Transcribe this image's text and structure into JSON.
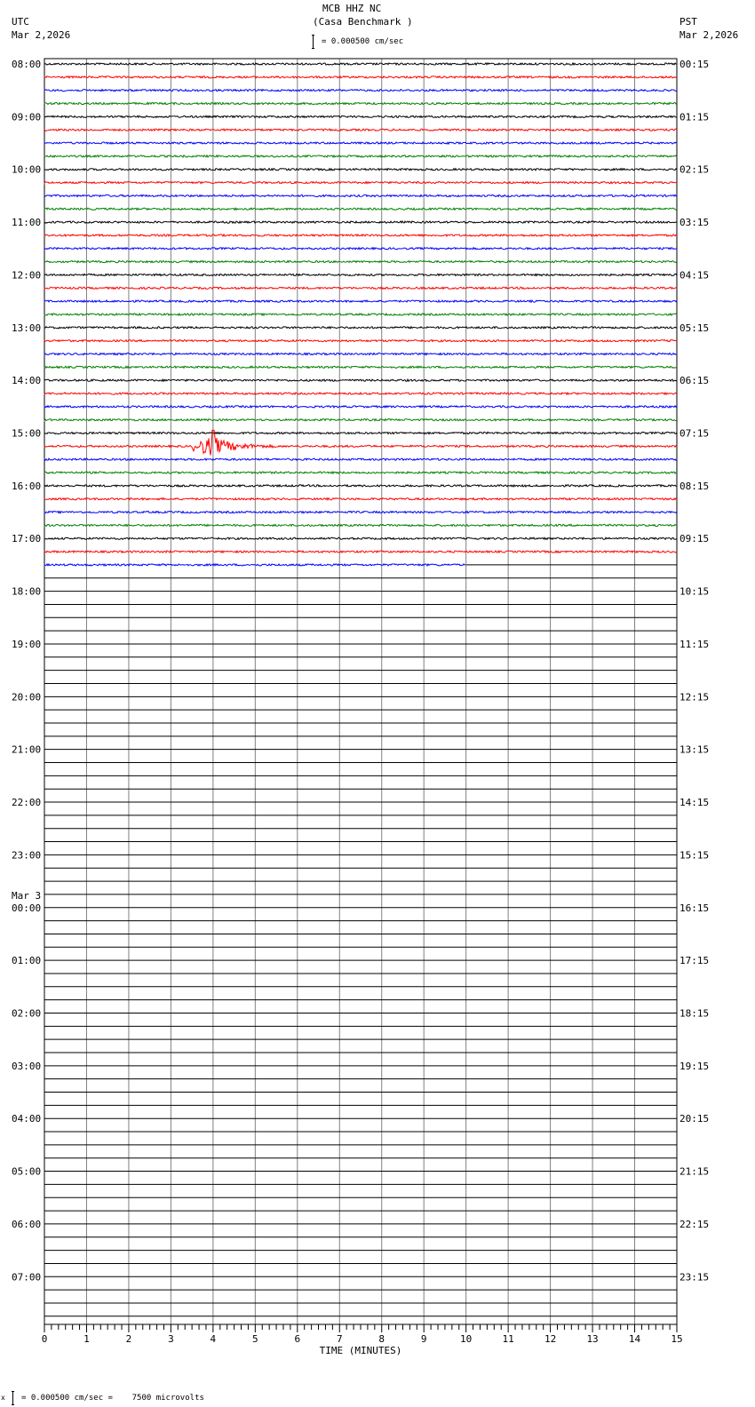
{
  "header": {
    "title": "MCB HHZ NC",
    "subtitle": "(Casa Benchmark )",
    "scale_text": "= 0.000500 cm/sec",
    "left_tz": "UTC",
    "left_date": "Mar 2,2026",
    "right_tz": "PST",
    "right_date": "Mar 2,2026"
  },
  "footer": {
    "scale_text": "= 0.000500 cm/sec =    7500 microvolts",
    "prefix": "x"
  },
  "chart_data": {
    "type": "line",
    "title": "MCB HHZ NC (Casa Benchmark )",
    "xlabel": "TIME (MINUTES)",
    "xlim": [
      0,
      15
    ],
    "x_ticks": [
      "0",
      "1",
      "2",
      "3",
      "4",
      "5",
      "6",
      "7",
      "8",
      "9",
      "10",
      "11",
      "12",
      "13",
      "14",
      "15"
    ],
    "rows_total": 96,
    "row_minutes": 15,
    "trace_colors": [
      "#000000",
      "#ff0000",
      "#0000ff",
      "#008000"
    ],
    "left_labels": [
      "08:00",
      "09:00",
      "10:00",
      "11:00",
      "12:00",
      "13:00",
      "14:00",
      "15:00",
      "16:00",
      "17:00",
      "18:00",
      "19:00",
      "20:00",
      "21:00",
      "22:00",
      "23:00",
      "00:00",
      "01:00",
      "02:00",
      "03:00",
      "04:00",
      "05:00",
      "06:00",
      "07:00"
    ],
    "date_change_label": "Mar 3",
    "date_change_hour_index": 16,
    "right_labels": [
      "00:15",
      "01:15",
      "02:15",
      "03:15",
      "04:15",
      "05:15",
      "06:15",
      "07:15",
      "08:15",
      "09:15",
      "10:15",
      "11:15",
      "12:15",
      "13:15",
      "14:15",
      "15:15",
      "16:15",
      "17:15",
      "18:15",
      "19:15",
      "20:15",
      "21:15",
      "22:15",
      "23:15"
    ],
    "rows_with_data": 39,
    "last_row_end_minute": 10,
    "events": [
      {
        "row": 29,
        "start_minute": 3.5,
        "peak_minute": 4.0,
        "end_minute": 5.5,
        "color": "#ff0000"
      }
    ]
  }
}
